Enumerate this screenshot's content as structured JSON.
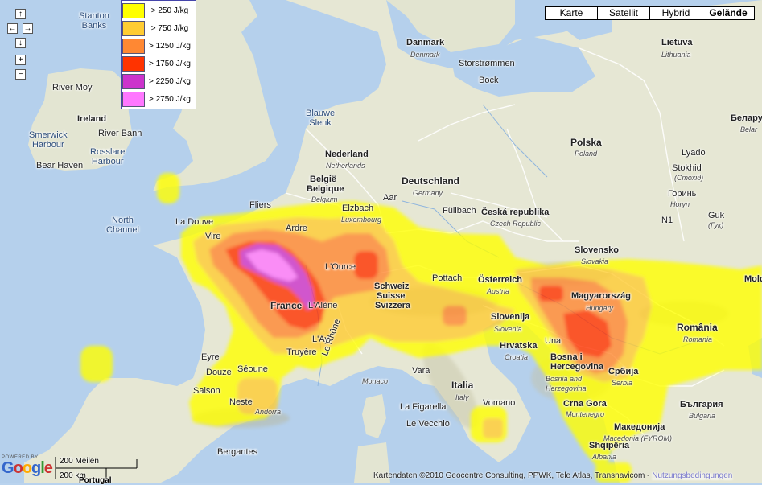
{
  "map_types": [
    {
      "label": "Karte",
      "active": false
    },
    {
      "label": "Satellit",
      "active": false
    },
    {
      "label": "Hybrid",
      "active": false
    },
    {
      "label": "Gelände",
      "active": true
    }
  ],
  "nav": {
    "up": "↑",
    "left": "←",
    "right": "→",
    "down": "↓",
    "zoom_in": "+",
    "zoom_out": "−"
  },
  "legend": [
    {
      "label": "> 250 J/kg",
      "color": "#ffff00"
    },
    {
      "label": "> 750 J/kg",
      "color": "#ffcc33"
    },
    {
      "label": "> 1250 J/kg",
      "color": "#ff8833"
    },
    {
      "label": "> 1750 J/kg",
      "color": "#ff3300"
    },
    {
      "label": "> 2250 J/kg",
      "color": "#cc33cc"
    },
    {
      "label": "> 2750 J/kg",
      "color": "#ff77ff"
    }
  ],
  "labels": {
    "stanton": "Stanton",
    "stanton2": "Banks",
    "river_moy": "River Moy",
    "ireland": "Ireland",
    "smerwick": "Smerwick",
    "smerwick2": "Harbour",
    "river_bann": "River Bann",
    "rosslare": "Rosslare",
    "rosslare2": "Harbour",
    "bear_haven": "Bear Haven",
    "north_channel": "North",
    "north_channel2": "Channel",
    "la_douve": "La Douve",
    "denmark": "Danmark",
    "denmark_sub": "Denmark",
    "storstrommen": "Storstrømmen",
    "bock": "Bock",
    "blauwe": "Blauwe",
    "blauwe2": "Slenk",
    "nederland": "Nederland",
    "netherlands": "Netherlands",
    "belgie": "België",
    "belgique": "Belgique",
    "belgium": "Belgium",
    "fliers": "Fliers",
    "aar": "Aar",
    "elzbach": "Elzbach",
    "luxembourg": "Luxembourg",
    "deutschland": "Deutschland",
    "germany": "Germany",
    "fullbach": "Füllbach",
    "ceska": "Česká republika",
    "czech": "Czech Republic",
    "polska": "Polska",
    "poland": "Poland",
    "lietuva": "Lietuva",
    "lithuania": "Lithuania",
    "belarus": "Белару",
    "belarus2": "Belar",
    "lyado": "Lyado",
    "stokhid": "Stokhid",
    "stokhid_cyr": "(Стохід)",
    "horyn": "Горинь",
    "horyn2": "Horyn",
    "guk": "Guk",
    "guk_cyr": "(Гук)",
    "n1": "N1",
    "vire": "Vire",
    "ardre": "Ardre",
    "lource": "L'Ource",
    "france": "France",
    "lalene": "L'Alène",
    "lay": "L'Ay",
    "truyere": "Truyère",
    "schweiz": "Schweiz",
    "suisse": "Suisse",
    "svizzera": "Svizzera",
    "pottach": "Pottach",
    "osterreich": "Österreich",
    "austria": "Austria",
    "slovensko": "Slovensko",
    "slovakia": "Slovakia",
    "magyarorszag": "Magyarország",
    "hungary": "Hungary",
    "romania": "România",
    "romania_sub": "Romania",
    "slovenija": "Slovenija",
    "slovenia": "Slovenia",
    "hrvatska": "Hrvatska",
    "croatia": "Croatia",
    "bosna": "Bosna i",
    "bosna2": "Hercegovina",
    "bosnia": "Bosnia and",
    "bosnia2": "Herzegovina",
    "srbija": "Србија",
    "serbia": "Serbia",
    "una": "Una",
    "crna_gora": "Crna Gora",
    "montenegro": "Montenegro",
    "makedonija": "Македонија",
    "macedonia": "Macedonia (FYROM)",
    "shqiperia": "Shqipëria",
    "albania": "Albania",
    "bulgaria": "България",
    "bulgaria_sub": "Bulgaria",
    "eyre": "Eyre",
    "douze": "Douze",
    "seoune": "Séoune",
    "le_rhone": "Le Rhône",
    "var": "Vara",
    "monaco": "Monaco",
    "italia": "Italia",
    "italy": "Italy",
    "la_figarella": "La Figarella",
    "le_vecchio": "Le Vecchio",
    "vomano": "Vomano",
    "saison": "Saison",
    "neste": "Neste",
    "andorra": "Andorra",
    "bergantes": "Bergantes",
    "mold": "Mold"
  },
  "footer": {
    "powered": "POWERED BY",
    "logo": "Google",
    "scale_miles": "200 Meilen",
    "scale_km": "200 km",
    "portugal": "Portugal",
    "copyright": "Kartendaten ©2010 Geocentre Consulting, PPWK, Tele Atlas, Transnavicom -",
    "terms": "Nutzungsbedingungen"
  }
}
